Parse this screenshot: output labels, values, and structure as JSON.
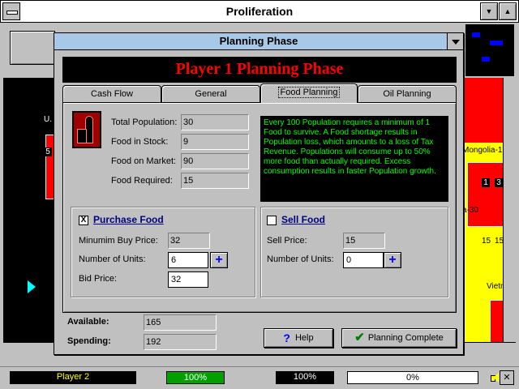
{
  "window": {
    "title": "Proliferation",
    "minimize_symbol": "▼",
    "maximize_symbol": "▲"
  },
  "map": {
    "labels": [
      "U.",
      "Mongolia-1",
      "a-30",
      "Vietn"
    ],
    "numbers": [
      "5",
      "1",
      "3",
      "15",
      "15"
    ]
  },
  "dialog": {
    "title": "Planning Phase",
    "banner": "Player 1 Planning Phase",
    "tabs": [
      "Cash Flow",
      "General",
      "Food Planning",
      "Oil Planning"
    ],
    "active_tab": "Food Planning",
    "stats": {
      "total_population_label": "Total Population:",
      "total_population": "30",
      "food_in_stock_label": "Food in Stock:",
      "food_in_stock": "9",
      "food_on_market_label": "Food on Market:",
      "food_on_market": "90",
      "food_required_label": "Food Required:",
      "food_required": "15"
    },
    "info_text": "Every 100 Population requires a minimum of 1 Food to survive.  A Food shortage results in Population loss,  which amounts to a loss of Tax Revenue.  Populations will consume up to 50% more food  than actually required.  Excess consumption results in faster Population growth.",
    "purchase": {
      "checked_mark": "X",
      "label": "Purchase Food",
      "min_price_label": "Minumim Buy Price:",
      "min_price": "32",
      "units_label": "Number of Units:",
      "units": "6",
      "bid_label": "Bid Price:",
      "bid": "32"
    },
    "sell": {
      "label": "Sell Food",
      "price_label": "Sell Price:",
      "price": "15",
      "units_label": "Number of Units:",
      "units": "0"
    },
    "plus_symbol": "+",
    "available_label": "Available:",
    "available": "165",
    "spending_label": "Spending:",
    "spending": "192",
    "help_icon": "?",
    "help_label": "Help",
    "complete_icon": "✔",
    "complete_label": "Planning Complete"
  },
  "status": {
    "player": "Player 2",
    "progress1": "100%",
    "progress2": "100%",
    "progress3": "0%",
    "close_symbol": "✕"
  },
  "colors": {
    "banner_text": "#ff0000",
    "info_text": "#00ff00",
    "dialog_title_bg": "#a8c8e8",
    "player_text": "#ffff00"
  }
}
